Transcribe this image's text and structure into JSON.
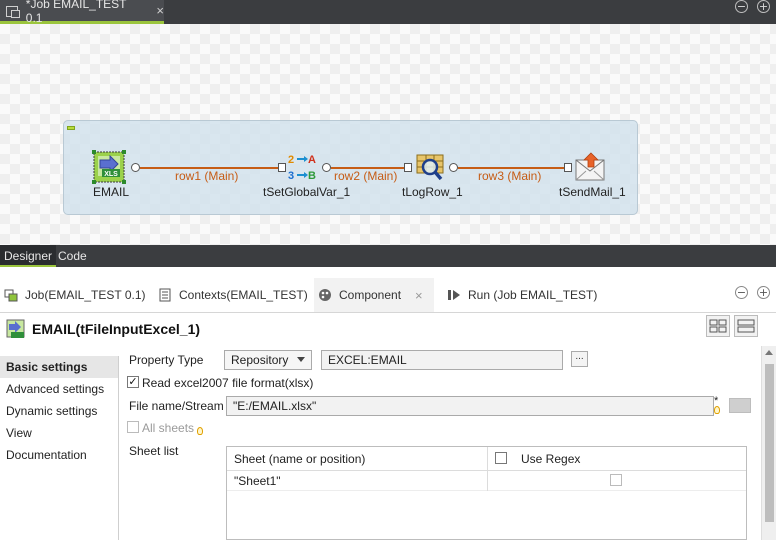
{
  "editor": {
    "job_tab_title": "*Job EMAIL_TEST 0.1",
    "close_symbol": "×"
  },
  "canvas": {
    "nodes": [
      {
        "label": "EMAIL",
        "icon": "excel-input-icon"
      },
      {
        "label": "tSetGlobalVar_1",
        "icon": "set-global-var-icon"
      },
      {
        "label": "tLogRow_1",
        "icon": "log-row-icon"
      },
      {
        "label": "tSendMail_1",
        "icon": "send-mail-icon"
      }
    ],
    "links": [
      "row1 (Main)",
      "row2 (Main)",
      "row3 (Main)"
    ],
    "icon_text": {
      "xls": "XLS",
      "n2": "2",
      "a": "A",
      "n3": "3",
      "b": "B"
    }
  },
  "view_tabs": {
    "designer": "Designer",
    "code": "Code"
  },
  "panel_tabs": [
    {
      "label": "Job(EMAIL_TEST 0.1)",
      "icon": "job-icon"
    },
    {
      "label": "Contexts(EMAIL_TEST)",
      "icon": "contexts-icon"
    },
    {
      "label": "Component",
      "icon": "palette-icon"
    },
    {
      "label": "Run (Job EMAIL_TEST)",
      "icon": "run-icon"
    }
  ],
  "component": {
    "title": "EMAIL(tFileInputExcel_1)"
  },
  "nav": [
    "Basic settings",
    "Advanced settings",
    "Dynamic settings",
    "View",
    "Documentation"
  ],
  "form": {
    "property_type_label": "Property Type",
    "property_type_value": "Repository",
    "repository_value": "EXCEL:EMAIL",
    "dots": "...",
    "read_excel2007_label": "Read excel2007 file format(xlsx)",
    "read_excel2007_checked": true,
    "check_mark": "✓",
    "filename_label": "File name/Stream",
    "filename_value": "\"E:/EMAIL.xlsx\"",
    "required_mark": "*",
    "all_sheets_label": "All sheets",
    "sheet_list_label": "Sheet list",
    "sheet_col_header": "Sheet (name or position)",
    "use_regex_label": "Use Regex",
    "sheets": [
      "\"Sheet1\""
    ]
  }
}
